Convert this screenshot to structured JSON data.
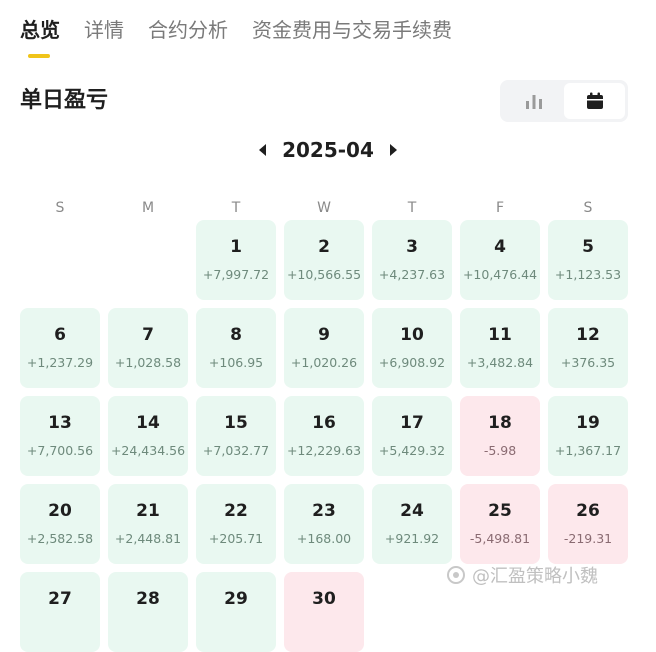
{
  "tabs": [
    "总览",
    "详情",
    "合约分析",
    "资金费用与交易手续费"
  ],
  "section_title": "单日盈亏",
  "view_toggle": {
    "options": [
      "bar-chart-icon",
      "calendar-icon"
    ],
    "selected": "calendar-icon"
  },
  "calendar": {
    "month": "2025-04",
    "weekdays": [
      "S",
      "M",
      "T",
      "W",
      "T",
      "F",
      "S"
    ],
    "leading_blanks": 2,
    "days": [
      {
        "day": "1",
        "pnl": "+7,997.72"
      },
      {
        "day": "2",
        "pnl": "+10,566.55"
      },
      {
        "day": "3",
        "pnl": "+4,237.63"
      },
      {
        "day": "4",
        "pnl": "+10,476.44"
      },
      {
        "day": "5",
        "pnl": "+1,123.53"
      },
      {
        "day": "6",
        "pnl": "+1,237.29"
      },
      {
        "day": "7",
        "pnl": "+1,028.58"
      },
      {
        "day": "8",
        "pnl": "+106.95"
      },
      {
        "day": "9",
        "pnl": "+1,020.26"
      },
      {
        "day": "10",
        "pnl": "+6,908.92"
      },
      {
        "day": "11",
        "pnl": "+3,482.84"
      },
      {
        "day": "12",
        "pnl": "+376.35"
      },
      {
        "day": "13",
        "pnl": "+7,700.56"
      },
      {
        "day": "14",
        "pnl": "+24,434.56"
      },
      {
        "day": "15",
        "pnl": "+7,032.77"
      },
      {
        "day": "16",
        "pnl": "+12,229.63"
      },
      {
        "day": "17",
        "pnl": "+5,429.32"
      },
      {
        "day": "18",
        "pnl": "-5.98"
      },
      {
        "day": "19",
        "pnl": "+1,367.17"
      },
      {
        "day": "20",
        "pnl": "+2,582.58"
      },
      {
        "day": "21",
        "pnl": "+2,448.81"
      },
      {
        "day": "22",
        "pnl": "+205.71"
      },
      {
        "day": "23",
        "pnl": "+168.00"
      },
      {
        "day": "24",
        "pnl": "+921.92"
      },
      {
        "day": "25",
        "pnl": "-5,498.81"
      },
      {
        "day": "26",
        "pnl": "-219.31"
      },
      {
        "day": "27",
        "pnl": ""
      },
      {
        "day": "28",
        "pnl": ""
      },
      {
        "day": "29",
        "pnl": ""
      },
      {
        "day": "30",
        "pnl": ""
      }
    ],
    "colors": {
      "profit_bg": "#e9f8f1",
      "loss_bg": "#fde8ec",
      "accent": "#f0c419"
    }
  },
  "watermark": "@汇盈策略小魏"
}
